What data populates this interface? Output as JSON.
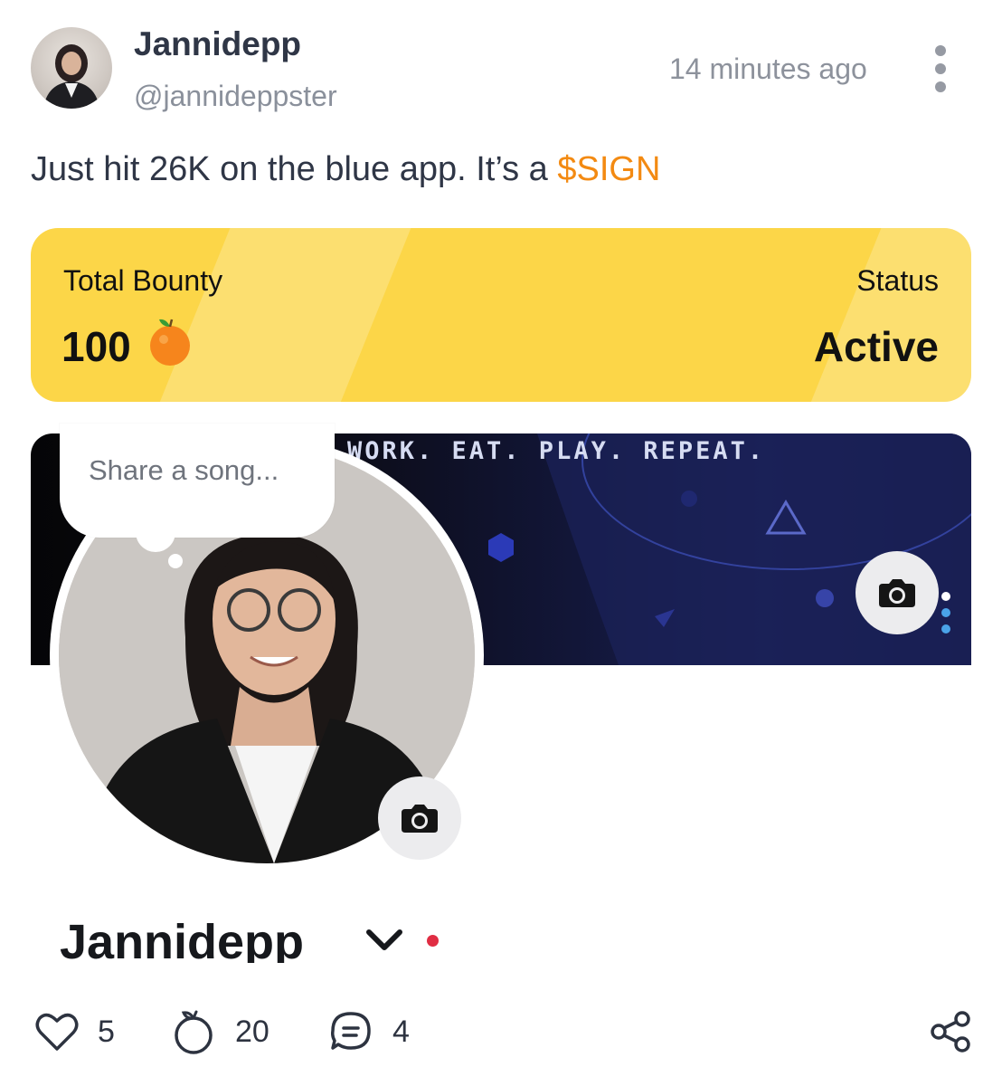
{
  "post": {
    "display_name": "Jannidepp",
    "handle": "@jannideppster",
    "timestamp": "14 minutes ago",
    "text_prefix": "Just hit 26K on the blue app. It’s a ",
    "ticker": "$SIGN",
    "ticker_color": "#f38a12"
  },
  "bounty": {
    "total_label": "Total Bounty",
    "total_value": "100",
    "token_icon": "orange-icon",
    "status_label": "Status",
    "status_value": "Active",
    "card_color": "#fcd648"
  },
  "profile": {
    "cover_motto": "WORK. EAT. PLAY. REPEAT.",
    "song_placeholder": "Share a song...",
    "name": "Jannidepp",
    "online_color": "#e02d43"
  },
  "actions": {
    "likes": "5",
    "oranges": "20",
    "comments": "4"
  }
}
